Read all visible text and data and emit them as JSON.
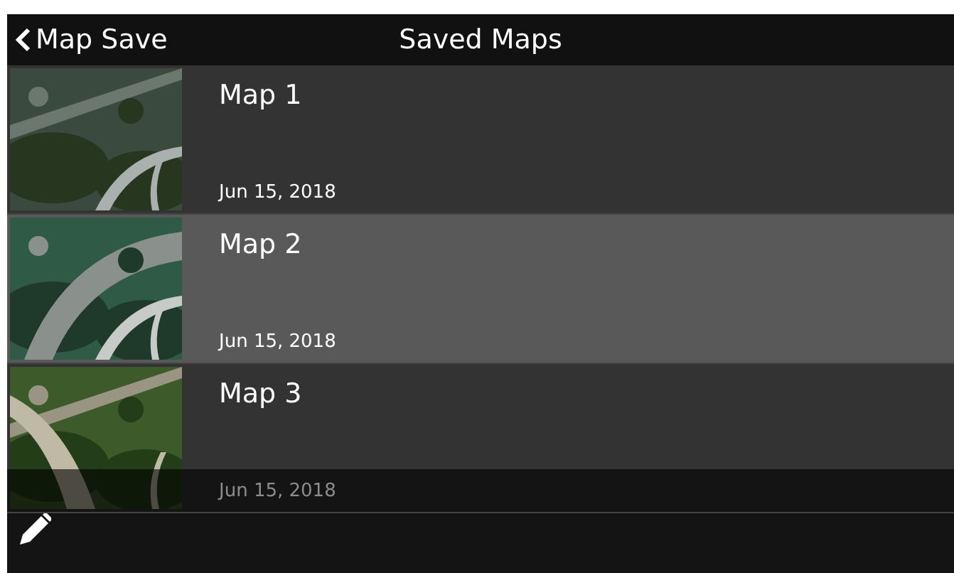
{
  "nav_bar": {
    "back_label": "Map Save",
    "title": "Saved Maps"
  },
  "maps": [
    {
      "name": "Map 1",
      "date": "Jun 15, 2018",
      "selected": false
    },
    {
      "name": "Map 2",
      "date": "Jun 15, 2018",
      "selected": true
    },
    {
      "name": "Map 3",
      "date": "Jun 15, 2018",
      "selected": false
    }
  ],
  "toolbar": {
    "edit": true
  }
}
